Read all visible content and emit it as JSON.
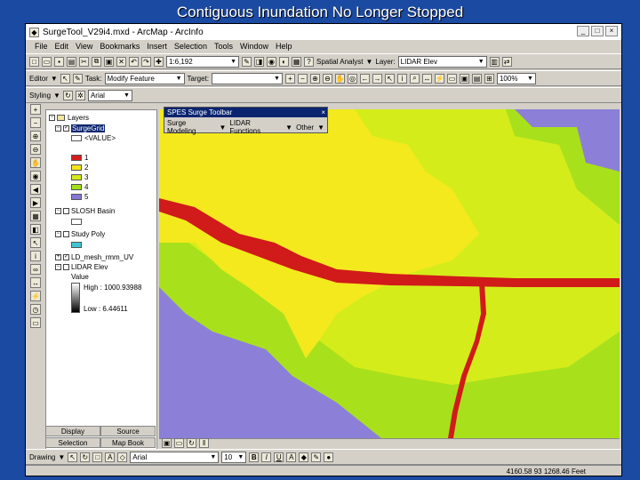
{
  "slide": {
    "title": "Contiguous Inundation No Longer Stopped"
  },
  "window": {
    "title": "SurgeTool_V29i4.mxd - ArcMap - ArcInfo",
    "btn_min": "_",
    "btn_max": "□",
    "btn_close": "×"
  },
  "menu": [
    "File",
    "Edit",
    "View",
    "Bookmarks",
    "Insert",
    "Selection",
    "Tools",
    "Window",
    "Help"
  ],
  "toolbar1": {
    "scale": "1:6,192",
    "spatial_analyst": "Spatial Analyst",
    "layer_label": "Layer:",
    "layer_value": "LIDAR Elev"
  },
  "toolbar2": {
    "editor": "Editor",
    "task_label": "Task:",
    "task_value": "Modify Feature",
    "target_label": "Target:",
    "zoom": "100%"
  },
  "toolbar3": {
    "styling": "Styling",
    "font": "Arial"
  },
  "toc": {
    "layers": "Layers",
    "surge_grid": "SurgeGrid",
    "value_header": "<VALUE>",
    "classes": [
      "1",
      "2",
      "3",
      "4",
      "5"
    ],
    "slosh": "SLOSH Basin",
    "study": "Study Poly",
    "mesh": "LD_mesh_rmm_UV",
    "lidar": "LIDAR Elev",
    "value": "Value",
    "high": "High : 1000.93988",
    "low": "Low : 6.44611"
  },
  "toc_tabs": [
    "Display",
    "Source",
    "Selection",
    "Map Book"
  ],
  "float_tb": {
    "title": "SPES Surge Toolbar",
    "menu1": "Surge Modeling",
    "menu2": "LIDAR Functions",
    "menu3": "Other"
  },
  "draw_tb": {
    "label": "Drawing",
    "font": "Arial",
    "size": "10",
    "bold": "B",
    "italic": "I",
    "underline": "U"
  },
  "status": {
    "coords": "4160.58 93  1268.46 Feet"
  },
  "colors": {
    "c1": "#d61c1c",
    "c2": "#f6e41a",
    "c3": "#d6ea1a",
    "c4": "#a3e017",
    "c5": "#8677d6"
  }
}
